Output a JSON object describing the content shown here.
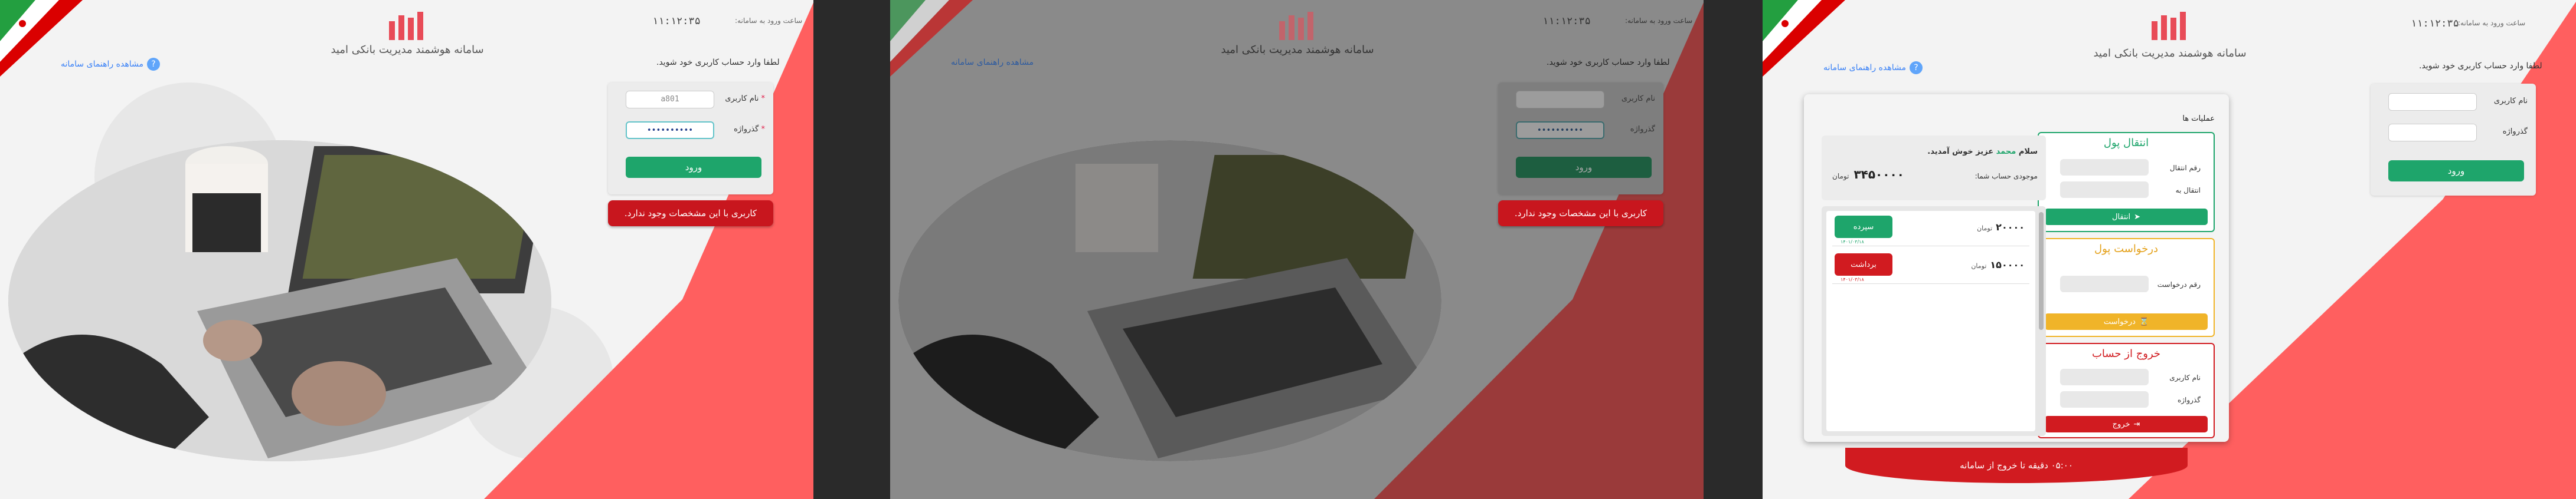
{
  "app_title": "سامانه هوشمند مدیریت بانکی امید",
  "clock": {
    "label": "ساعت ورود به سامانه:",
    "time": "۱۱:۱۲:۳۵"
  },
  "help_link": "مشاهده راهنمای سامانه",
  "login": {
    "prompt": "لطفا وارد حساب کاربری خود شوید.",
    "username_label": "نام کاربری",
    "password_label": "گذرواژه",
    "required_mark": "*",
    "username_value": "a801",
    "password_value": "••••••••••",
    "submit": "ورود",
    "error": "کاربری با این مشخصات وجود ندارد."
  },
  "dashboard": {
    "title": "عملیات ها",
    "greeting_prefix": "سلام",
    "user": "محمد",
    "greeting_suffix": "عزیز خوش آمدید.",
    "balance_label": "موجودی حساب شما:",
    "balance": "۳۴۵۰۰۰۰",
    "currency": "تومان",
    "transactions": [
      {
        "amount": "۲۰۰۰۰",
        "currency": "تومان",
        "type": "سپرده",
        "date": "۱۴۰۱/۰۳/۱۸"
      },
      {
        "amount": "۱۵۰۰۰۰",
        "currency": "تومان",
        "type": "برداشت",
        "date": "۱۴۰۱/۰۳/۱۸"
      }
    ],
    "transfer": {
      "title": "انتقال پول",
      "amount_label": "رقم انتقال",
      "to_label": "انتقال به",
      "button": "انتقال"
    },
    "request": {
      "title": "درخواست پول",
      "amount_label": "رقم درخواست",
      "button": "درخواست"
    },
    "logout": {
      "title": "خروج از حساب",
      "username_label": "نام کاربری",
      "password_label": "گذرواژه",
      "button": "خروج"
    },
    "timer": "۰۵:۰۰ دقیقه تا خروج از سامانه"
  },
  "colors": {
    "accent_red": "#ff5f5f",
    "green": "#1ea56b",
    "error": "#c8161e",
    "yellow": "#f0b429"
  }
}
